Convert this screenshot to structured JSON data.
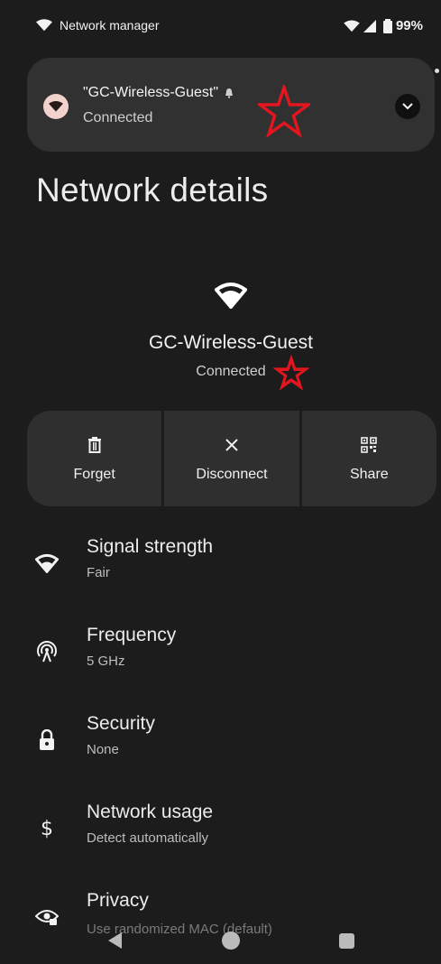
{
  "status_bar": {
    "app_title": "Network manager",
    "battery": "99%"
  },
  "notification": {
    "title": "\"GC-Wireless-Guest\"",
    "status": "Connected"
  },
  "page": {
    "title": "Network details"
  },
  "network": {
    "name": "GC-Wireless-Guest",
    "status": "Connected"
  },
  "actions": [
    {
      "label": "Forget",
      "icon": "trash-icon"
    },
    {
      "label": "Disconnect",
      "icon": "close-icon"
    },
    {
      "label": "Share",
      "icon": "qr-code-icon"
    }
  ],
  "details": [
    {
      "title": "Signal strength",
      "value": "Fair",
      "icon": "wifi-icon"
    },
    {
      "title": "Frequency",
      "value": "5 GHz",
      "icon": "antenna-icon"
    },
    {
      "title": "Security",
      "value": "None",
      "icon": "lock-icon"
    },
    {
      "title": "Network usage",
      "value": "Detect automatically",
      "icon": "dollar-icon"
    },
    {
      "title": "Privacy",
      "value": "Use randomized MAC (default)",
      "icon": "eye-lock-icon"
    }
  ],
  "colors": {
    "background": "#1c1c1c",
    "card": "#313131",
    "accent_icon_bg": "#f2d2cc",
    "annotation_star": "#e3151f"
  }
}
